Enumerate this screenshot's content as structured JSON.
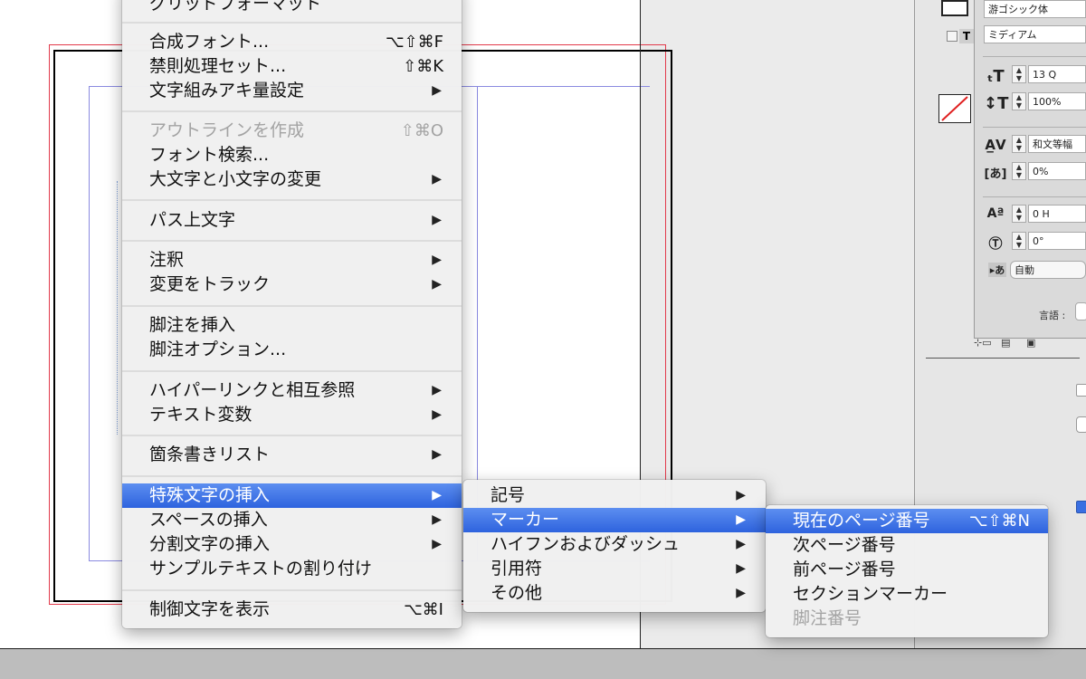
{
  "main_menu": {
    "items": [
      {
        "label": "グリッドフォーマット",
        "shortcut": "",
        "submenu": false,
        "disabled": false
      },
      {
        "label": "合成フォント...",
        "shortcut": "⌥⇧⌘F",
        "submenu": false,
        "disabled": false
      },
      {
        "label": "禁則処理セット...",
        "shortcut": "⇧⌘K",
        "submenu": false,
        "disabled": false
      },
      {
        "label": "文字組みアキ量設定",
        "shortcut": "",
        "submenu": true,
        "disabled": false
      },
      {
        "label": "アウトラインを作成",
        "shortcut": "⇧⌘O",
        "submenu": false,
        "disabled": true
      },
      {
        "label": "フォント検索...",
        "shortcut": "",
        "submenu": false,
        "disabled": false
      },
      {
        "label": "大文字と小文字の変更",
        "shortcut": "",
        "submenu": true,
        "disabled": false
      },
      {
        "label": "パス上文字",
        "shortcut": "",
        "submenu": true,
        "disabled": false
      },
      {
        "label": "注釈",
        "shortcut": "",
        "submenu": true,
        "disabled": false
      },
      {
        "label": "変更をトラック",
        "shortcut": "",
        "submenu": true,
        "disabled": false
      },
      {
        "label": "脚注を挿入",
        "shortcut": "",
        "submenu": false,
        "disabled": false
      },
      {
        "label": "脚注オプション...",
        "shortcut": "",
        "submenu": false,
        "disabled": false
      },
      {
        "label": "ハイパーリンクと相互参照",
        "shortcut": "",
        "submenu": true,
        "disabled": false
      },
      {
        "label": "テキスト変数",
        "shortcut": "",
        "submenu": true,
        "disabled": false
      },
      {
        "label": "箇条書きリスト",
        "shortcut": "",
        "submenu": true,
        "disabled": false
      },
      {
        "label": "特殊文字の挿入",
        "shortcut": "",
        "submenu": true,
        "disabled": false,
        "highlighted": true
      },
      {
        "label": "スペースの挿入",
        "shortcut": "",
        "submenu": true,
        "disabled": false
      },
      {
        "label": "分割文字の挿入",
        "shortcut": "",
        "submenu": true,
        "disabled": false
      },
      {
        "label": "サンプルテキストの割り付け",
        "shortcut": "",
        "submenu": false,
        "disabled": false
      },
      {
        "label": "制御文字を表示",
        "shortcut": "⌥⌘I",
        "submenu": false,
        "disabled": false
      }
    ],
    "arrow_glyph": "▶"
  },
  "special_chars_submenu": {
    "items": [
      {
        "label": "記号",
        "highlighted": false
      },
      {
        "label": "マーカー",
        "highlighted": true
      },
      {
        "label": "ハイフンおよびダッシュ",
        "highlighted": false
      },
      {
        "label": "引用符",
        "highlighted": false
      },
      {
        "label": "その他",
        "highlighted": false
      }
    ]
  },
  "marker_submenu": {
    "items": [
      {
        "label": "現在のページ番号",
        "shortcut": "⌥⇧⌘N",
        "highlighted": true,
        "disabled": false
      },
      {
        "label": "次ページ番号",
        "shortcut": "",
        "highlighted": false,
        "disabled": false
      },
      {
        "label": "前ページ番号",
        "shortcut": "",
        "highlighted": false,
        "disabled": false
      },
      {
        "label": "セクションマーカー",
        "shortcut": "",
        "highlighted": false,
        "disabled": false
      },
      {
        "label": "脚注番号",
        "shortcut": "",
        "highlighted": false,
        "disabled": true
      }
    ]
  },
  "character_panel": {
    "font_family": "游ゴシック体",
    "font_style": "ミディアム",
    "font_size": "13 Q",
    "vertical_scale": "100%",
    "tracking_mode": "和文等幅",
    "tsume": "0%",
    "baseline_shift": "0 H",
    "rotation": "0°",
    "auto_label": "自動",
    "language_label": "言語 :",
    "icons": [
      "font-size-icon",
      "vertical-scale-icon",
      "tracking-icon",
      "tsume-icon",
      "baseline-shift-icon",
      "rotation-icon",
      "kana-icon"
    ]
  },
  "colors": {
    "highlight": "#3a6fe2",
    "bleed_guide": "#e23a4b",
    "margin_guide": "#8a8ae0",
    "column_guide": "#d65ac8"
  }
}
